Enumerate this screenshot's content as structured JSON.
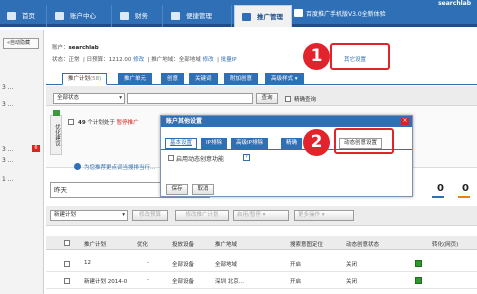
{
  "topnav": {
    "tabs": [
      {
        "label": "首页"
      },
      {
        "label": "账户中心"
      },
      {
        "label": "财务"
      },
      {
        "label": "便捷管理"
      },
      {
        "label": "推广管理"
      }
    ],
    "banner": "百度推广手机版V3.0全新体验",
    "user": "searchlab"
  },
  "left": {
    "button": "«自动隐藏",
    "items": [
      "3 ...",
      "3 ...",
      "3 ...",
      "3 ...",
      "1 ..."
    ],
    "badge": "6"
  },
  "account": {
    "label": "账户：",
    "name": "searchlab",
    "status_label": "状态：",
    "status_value": "正常",
    "budget_label": "日预算：",
    "budget_value": "1212.00",
    "edit1": "修改",
    "region_label": "推广地域：",
    "region_value": "全部地域",
    "edit2": "修改",
    "ip_exclude": "批量IP",
    "other_settings": "其它设置"
  },
  "subtabs": [
    {
      "label": "推广计划",
      "count": "(58)"
    },
    {
      "label": "推广单元"
    },
    {
      "label": "创意"
    },
    {
      "label": "关键词"
    },
    {
      "label": "附加创意"
    },
    {
      "label": "高级样式"
    }
  ],
  "filter": {
    "status": "全部状态",
    "query_button": "查询",
    "exact_label": "精确查询"
  },
  "optimize": {
    "side_label": "优化建议",
    "count": "49",
    "text": "个计划处于",
    "status": "暂停推广"
  },
  "tip": "为您推荐更点词当搜排当行...",
  "date": "昨天",
  "metrics": [
    "0",
    "0"
  ],
  "toolbar": {
    "new_plan": "新建计划",
    "edit_budget": "修改预算",
    "edit_plan": "修改推广计划",
    "enable_pause": "启用/暂停",
    "more": "更多操作"
  },
  "table": {
    "headers": [
      "推广计划",
      "优化",
      "投放设备",
      "推广地域",
      "搜索意图定位",
      "动态创意状态",
      "转化(网页)"
    ],
    "rows": [
      {
        "plan": "12",
        "opt": "-",
        "device": "全部设备",
        "region": "全部地域",
        "intent": "开启",
        "dynamic": "关闭"
      },
      {
        "plan": "新建计划 2014-0",
        "opt": "-",
        "device": "全部设备",
        "region": "深圳 北京...",
        "intent": "开启",
        "dynamic": "关闭"
      }
    ]
  },
  "dialog": {
    "title": "账户其他设置",
    "close": "×",
    "tabs": [
      "基本设置",
      "IP排除",
      "高级IP排除",
      "精确",
      "动态创意设置"
    ],
    "checkbox_label": "启用动态创意功能",
    "help": "?",
    "save": "保存",
    "cancel": "取消"
  },
  "callouts": {
    "one": "1",
    "two": "2"
  }
}
